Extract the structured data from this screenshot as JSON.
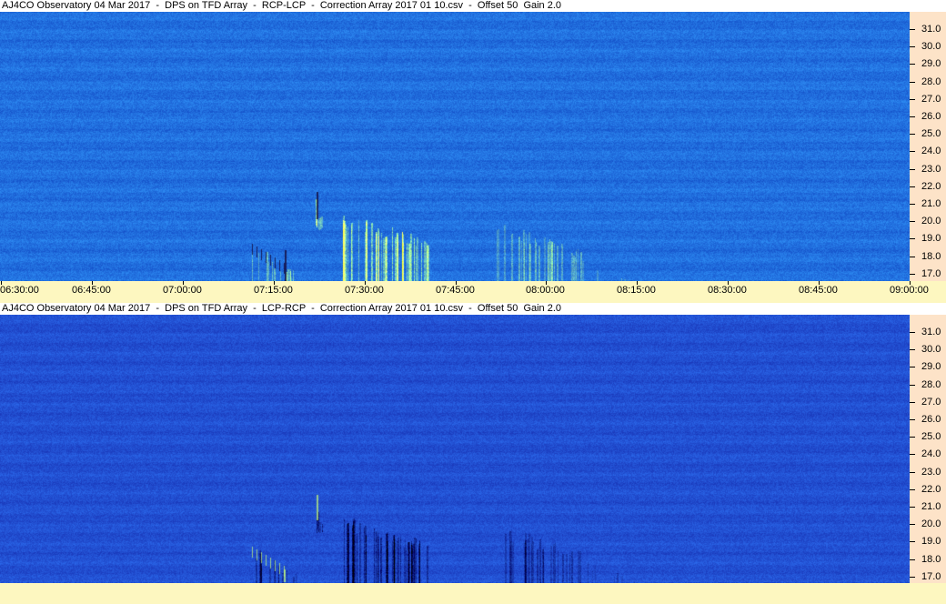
{
  "panels": [
    {
      "id": "rcp-lcp",
      "title": "AJ4CO Observatory 04 Mar 2017  -  DPS on TFD Array  -  RCP-LCP  -  Correction Array 2017 01 10.csv  -  Offset 50  Gain 2.0",
      "y_labels": [
        "31.0",
        "30.0",
        "29.0",
        "28.0",
        "27.0",
        "26.0",
        "25.0",
        "24.0",
        "23.0",
        "22.0",
        "21.0",
        "20.0",
        "19.0",
        "18.0",
        "17.0"
      ],
      "x_labels": [
        "06:30:00",
        "06:45:00",
        "07:00:00",
        "07:15:00",
        "07:30:00",
        "07:45:00",
        "08:00:00",
        "08:15:00",
        "08:30:00",
        "08:45:00",
        "09:00:00"
      ]
    },
    {
      "id": "lcp-rcp",
      "title": "AJ4CO Observatory 04 Mar 2017  -  DPS on TFD Array  -  LCP-RCP  -  Correction Array 2017 01 10.csv  -  Offset 50  Gain 2.0",
      "y_labels": [
        "31.0",
        "30.0",
        "29.0",
        "28.0",
        "27.0",
        "26.0",
        "25.0",
        "24.0",
        "23.0",
        "22.0",
        "21.0",
        "20.0",
        "19.0",
        "18.0",
        "17.0"
      ],
      "x_labels": []
    }
  ],
  "colors": {
    "axis_background": "#fde3c8",
    "time_axis_background": "#fdf7c0",
    "top_panel_base": "#1a6fe8",
    "bottom_panel_base": "#1d4fd8"
  }
}
